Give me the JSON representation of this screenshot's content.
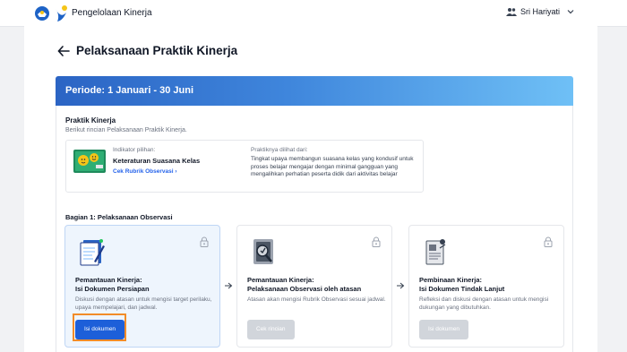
{
  "header": {
    "app_title": "Pengelolaan Kinerja",
    "user_name": "Sri Hariyati",
    "logo_icons": [
      "kemendikbud-logo-icon",
      "platform-logo-icon"
    ]
  },
  "page": {
    "title": "Pelaksanaan Praktik Kinerja",
    "period": "Periode: 1 Januari - 30 Juni"
  },
  "praktik": {
    "title": "Praktik Kinerja",
    "subtitle": "Berikut rincian Pelaksanaan Praktik Kinerja.",
    "indicator_label": "Indikator pilihan:",
    "indicator_name": "Keteraturan Suasana Kelas",
    "indicator_link": "Cek Rubrik Observasi",
    "observed_label": "Praktiknya dilihat dari:",
    "observed_text": "Tingkat upaya membangun suasana kelas yang kondusif untuk proses belajar mengajar dengan minimal gangguan yang mengalihkan perhatian peserta didik dari aktivitas belajar"
  },
  "section": {
    "title": "Bagian 1: Pelaksanaan Observasi"
  },
  "steps": [
    {
      "title_line1": "Pemantauan Kinerja:",
      "title_line2": "Isi Dokumen Persiapan",
      "desc": "Diskusi dengan atasan untuk mengisi target perilaku, upaya mempelajari, dan jadwal.",
      "button": "Isi dokumen",
      "active": true
    },
    {
      "title_line1": "Pemantauan Kinerja:",
      "title_line2": "Pelaksanaan Observasi oleh atasan",
      "desc": "Atasan akan mengisi Rubrik Observasi sesuai jadwal.",
      "button": "Cek rincian",
      "active": false
    },
    {
      "title_line1": "Pembinaan Kinerja:",
      "title_line2": "Isi Dokumen Tindak Lanjut",
      "desc": "Refleksi dan diskusi dengan atasan untuk mengisi dukungan yang dibutuhkan.",
      "button": "Isi dokumen",
      "active": false
    }
  ],
  "colors": {
    "banner_start": "#2b64c4",
    "banner_end": "#6fc0f6",
    "primary_button": "#1d5fd9",
    "highlight_border": "#f28c28",
    "link": "#2563eb"
  }
}
